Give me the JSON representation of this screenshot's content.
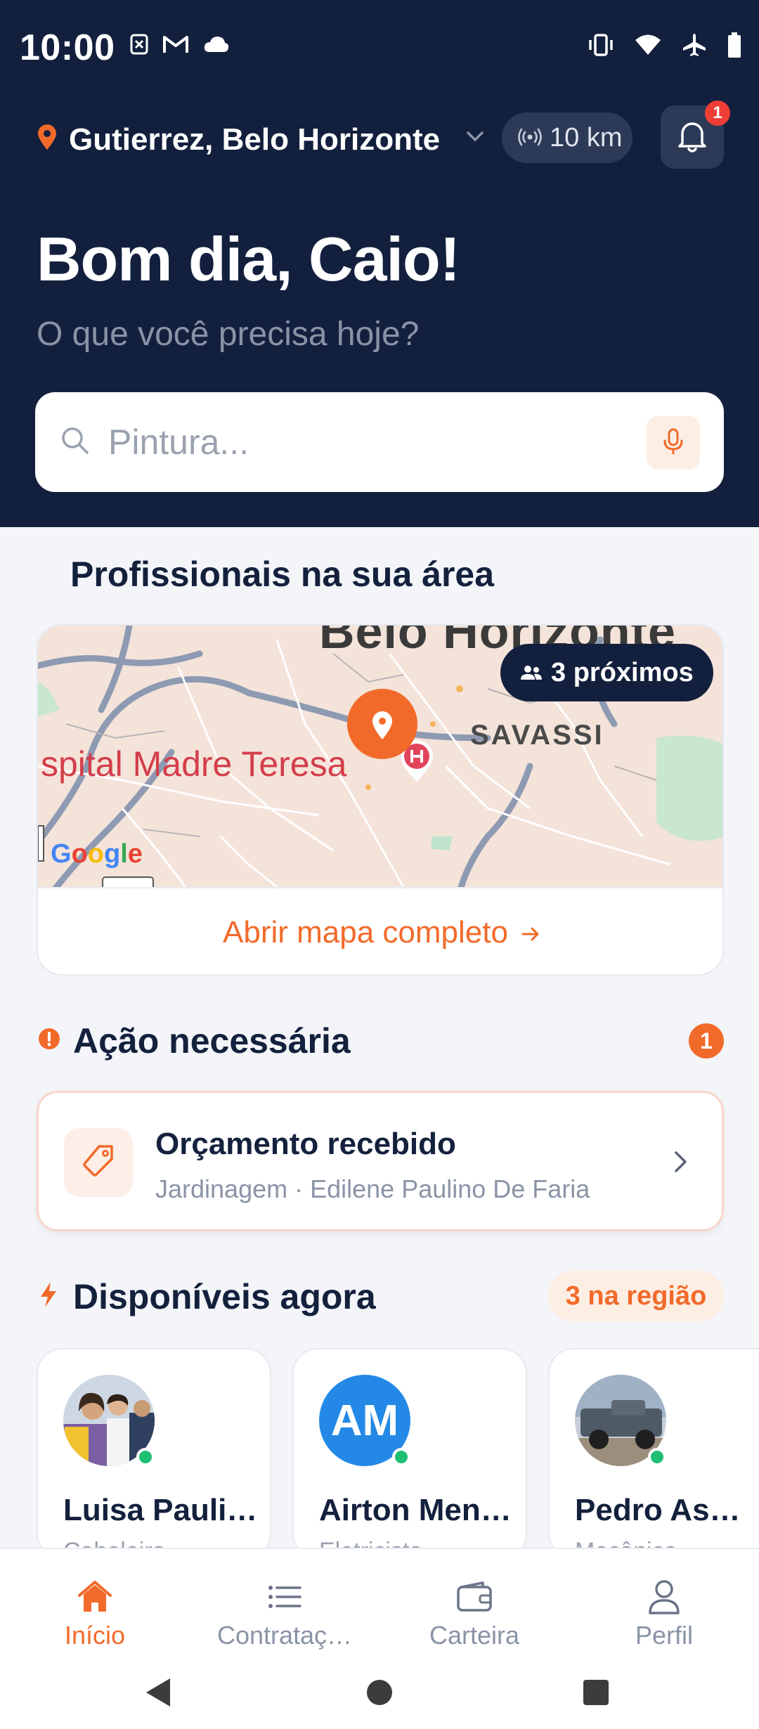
{
  "status_bar": {
    "time": "10:00"
  },
  "location": {
    "label": "Gutierrez, Belo Horizonte",
    "radius": "10 km",
    "notification_count": "1"
  },
  "greeting": {
    "title": "Bom dia, Caio!",
    "subtitle": "O que você precisa hoje?"
  },
  "search": {
    "placeholder": "Pintura..."
  },
  "map_section": {
    "title": "Profissionais na sua área",
    "nearby_chip": "3 próximos",
    "map_labels": {
      "city": "Belo Horizonte",
      "hospital": "spital Madre Teresa",
      "district": "SAVASSI",
      "google": "Google"
    },
    "open_map_link": "Abrir mapa completo"
  },
  "action_section": {
    "title": "Ação necessária",
    "count": "1",
    "card": {
      "title": "Orçamento recebido",
      "subtitle": "Jardinagem · Edilene Paulino De Faria"
    }
  },
  "available_section": {
    "title": "Disponíveis agora",
    "region_chip": "3 na região",
    "professionals": [
      {
        "name": "Luisa Pauli…",
        "role": "Cabeleira",
        "initials": ""
      },
      {
        "name": "Airton Men…",
        "role": "Eletricista",
        "initials": "AM"
      },
      {
        "name": "Pedro Assi…",
        "role": "Mecânico",
        "initials": ""
      }
    ]
  },
  "bottom_nav": {
    "items": [
      {
        "label": "Início",
        "active": true
      },
      {
        "label": "Contrataç…",
        "active": false
      },
      {
        "label": "Carteira",
        "active": false
      },
      {
        "label": "Perfil",
        "active": false
      }
    ]
  },
  "colors": {
    "navy": "#13203d",
    "accent": "#f26a2a",
    "online": "#1fbf73",
    "badge_red": "#ef3e36"
  }
}
